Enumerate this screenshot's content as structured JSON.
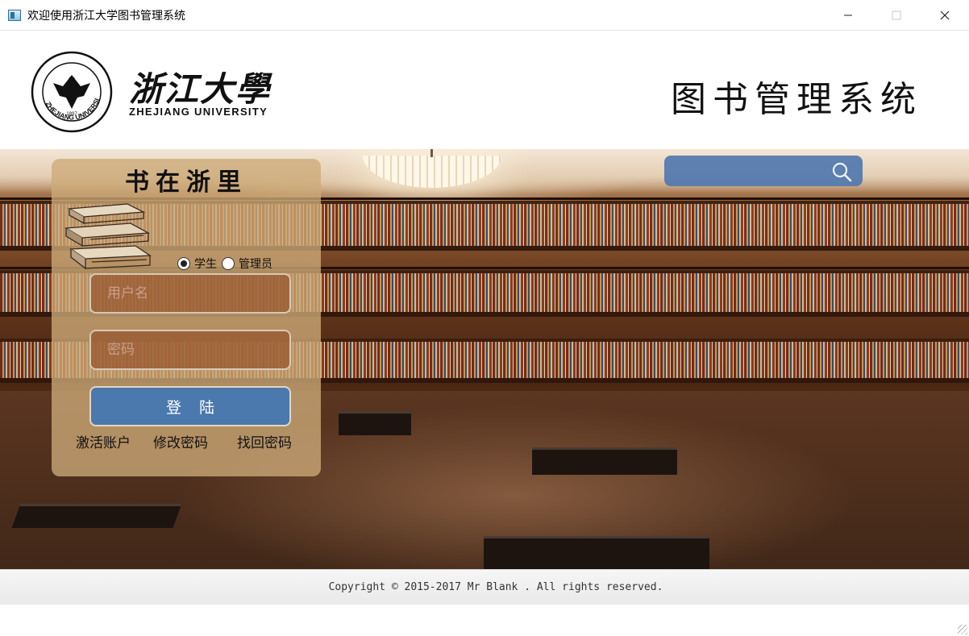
{
  "window": {
    "title": "欢迎使用浙江大学图书管理系统",
    "controls": {
      "minimize": "minimize-icon",
      "maximize": "maximize-icon",
      "close": "close-icon"
    }
  },
  "header": {
    "university_cn": "浙江大學",
    "university_en": "ZHEJIANG UNIVERSITY",
    "system_title": "图书管理系统",
    "seal_text": "ZHEJIANG UNIVERSITY",
    "seal_year": "1897"
  },
  "search": {
    "placeholder": "",
    "icon": "search-icon"
  },
  "login": {
    "slogan": "书在浙里",
    "roles": [
      {
        "label": "学生",
        "checked": true
      },
      {
        "label": "管理员",
        "checked": false
      }
    ],
    "username_placeholder": "用户名",
    "password_placeholder": "密码",
    "login_label": "登陆",
    "links": {
      "activate": "激活账户",
      "modify": "修改密码",
      "recover": "找回密码"
    }
  },
  "footer": {
    "copyright": "Copyright © 2015-2017 Mr Blank . All rights reserved."
  },
  "colors": {
    "accent": "#4b78ad",
    "panel": "#cdaa78",
    "field": "#965530"
  }
}
